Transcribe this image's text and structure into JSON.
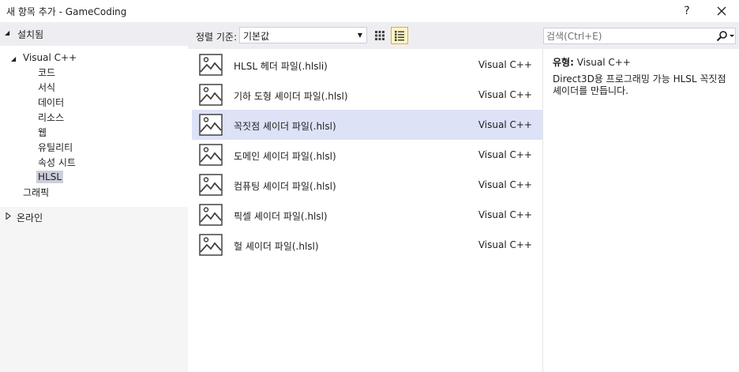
{
  "window": {
    "title": "새 항목 추가 - GameCoding",
    "help_label": "?",
    "close_label": "✕"
  },
  "left_panel": {
    "header": "설치됨",
    "tree": {
      "visual_cpp": "Visual C++",
      "children": [
        "코드",
        "서식",
        "데이터",
        "리소스",
        "웹",
        "유틸리티",
        "속성 시트",
        "HLSL"
      ],
      "graphics": "그래픽",
      "online": "온라인"
    }
  },
  "toolbar": {
    "sort_label": "정렬 기준:",
    "sort_value": "기본값",
    "search_placeholder": "검색(Ctrl+E)"
  },
  "templates": [
    {
      "name": "HLSL 헤더 파일(.hlsli)",
      "lang": "Visual C++"
    },
    {
      "name": "기하 도형 셰이더 파일(.hlsl)",
      "lang": "Visual C++"
    },
    {
      "name": "꼭짓점 셰이더 파일(.hlsl)",
      "lang": "Visual C++"
    },
    {
      "name": "도메인 셰이더 파일(.hlsl)",
      "lang": "Visual C++"
    },
    {
      "name": "컴퓨팅 셰이더 파일(.hlsl)",
      "lang": "Visual C++"
    },
    {
      "name": "픽셀 셰이더 파일(.hlsl)",
      "lang": "Visual C++"
    },
    {
      "name": "헐 셰이더 파일(.hlsl)",
      "lang": "Visual C++"
    }
  ],
  "details": {
    "type_label": "유형:",
    "type_value": "Visual C++",
    "description": "Direct3D용 프로그래밍 가능 HLSL 꼭짓점 셰이더를 만듭니다."
  },
  "colors": {
    "selected_row": "#dde2f7",
    "tree_selected": "#cccedb",
    "panel_header": "#eeeef2",
    "list_view_active": "#e8a93b"
  }
}
